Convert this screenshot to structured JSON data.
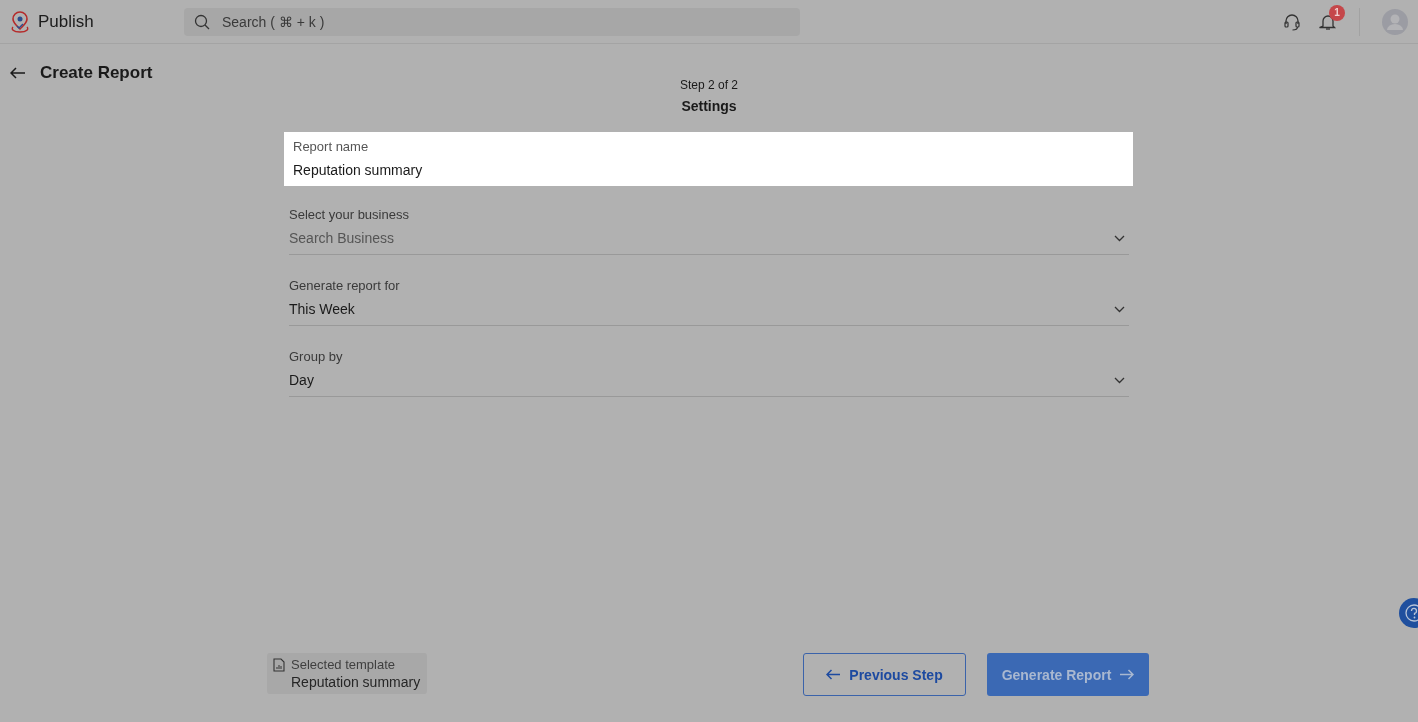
{
  "app": {
    "name": "Publish"
  },
  "search": {
    "placeholder": "Search ( ⌘ + k )"
  },
  "notifications": {
    "count": "1"
  },
  "page": {
    "title": "Create Report",
    "step": "Step 2 of 2",
    "section": "Settings"
  },
  "fields": [
    {
      "kind": "text",
      "label": "Report name",
      "value": "Reputation summary",
      "highlighted": true
    },
    {
      "kind": "select",
      "label": "Select your business",
      "placeholder": "Search Business",
      "highlighted": false
    },
    {
      "kind": "select",
      "label": "Generate report for",
      "value": "This Week",
      "highlighted": false
    },
    {
      "kind": "select",
      "label": "Group by",
      "value": "Day",
      "highlighted": false
    }
  ],
  "template": {
    "label": "Selected template",
    "name": "Reputation summary"
  },
  "buttons": {
    "previous": "Previous Step",
    "generate": "Generate Report"
  }
}
